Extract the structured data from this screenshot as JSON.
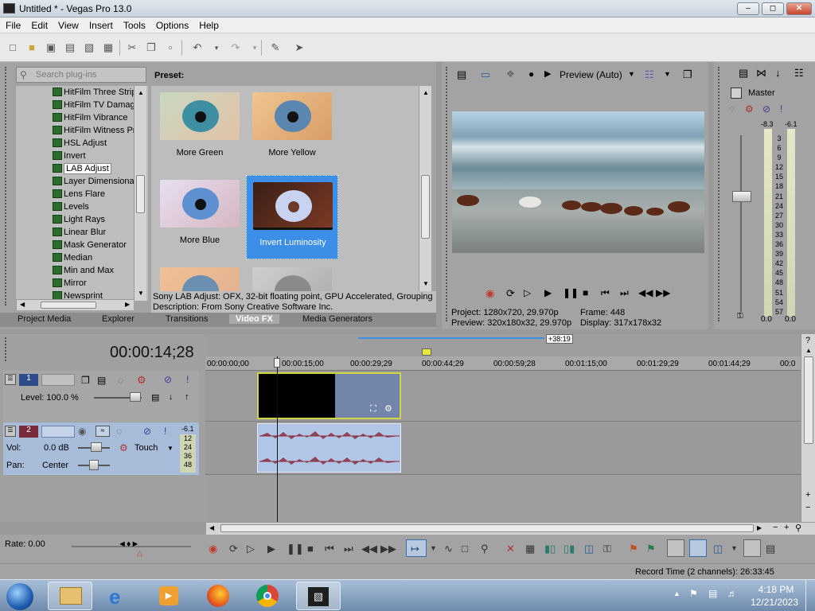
{
  "window": {
    "title": "Untitled * - Vegas Pro 13.0"
  },
  "menu": [
    "File",
    "Edit",
    "View",
    "Insert",
    "Tools",
    "Options",
    "Help"
  ],
  "plugins": {
    "search_placeholder": "Search plug-ins",
    "items": [
      "HitFilm Three Strip",
      "HitFilm TV Damage",
      "HitFilm Vibrance",
      "HitFilm Witness Pr",
      "HSL Adjust",
      "Invert",
      "LAB Adjust",
      "Layer Dimensional",
      "Lens Flare",
      "Levels",
      "Light Rays",
      "Linear Blur",
      "Mask Generator",
      "Median",
      "Min and Max",
      "Mirror",
      "Newsprint"
    ],
    "selected": "LAB Adjust"
  },
  "presets": {
    "label": "Preset:",
    "items": [
      {
        "name": "More Green",
        "iris": "#3f8fa3",
        "tint": "#cbe3d0"
      },
      {
        "name": "More Yellow",
        "iris": "#5a86b0",
        "tint": "#f0c58e"
      },
      {
        "name": "More Blue",
        "iris": "#5e8fd0",
        "tint": "#e7dff0"
      },
      {
        "name": "Invert Luminosity",
        "iris": "#c7d3f1",
        "tint": "#3a1e16"
      },
      {
        "name": "",
        "iris": "#6a8fb0",
        "tint": "#f0c096"
      },
      {
        "name": "",
        "iris": "#8a8a8a",
        "tint": "#cfcfcf"
      }
    ],
    "selected": "Invert Luminosity",
    "description_line1": "Sony LAB Adjust: OFX, 32-bit floating point, GPU Accelerated, Grouping",
    "description_line2": "Description: From Sony Creative Software Inc."
  },
  "tabs": [
    "Project Media",
    "Explorer",
    "Transitions",
    "Video FX",
    "Media Generators"
  ],
  "active_tab": "Video FX",
  "preview": {
    "mode": "Preview (Auto)",
    "project_label": "Project:",
    "project": "1280x720, 29.970p",
    "preview_label": "Preview:",
    "preview_res": "320x180x32, 29.970p",
    "frame_label": "Frame:",
    "frame": "448",
    "display_label": "Display:",
    "display": "317x178x32"
  },
  "master": {
    "label": "Master",
    "peak_left": "-8.3",
    "peak_right": "-6.1",
    "scale": [
      "3",
      "6",
      "9",
      "12",
      "15",
      "18",
      "21",
      "24",
      "27",
      "30",
      "33",
      "36",
      "39",
      "42",
      "45",
      "48",
      "51",
      "54",
      "57"
    ],
    "bottom_left": "0.0",
    "bottom_right": "0.0"
  },
  "timeline": {
    "timecode": "00:00:14;28",
    "ruler": [
      "00:00:00;00",
      "00:00:15;00",
      "00:00:29;29",
      "00:00:44;29",
      "00:00:59;28",
      "00:01:15;00",
      "00:01:29;29",
      "00:01:44;29",
      "00:0"
    ],
    "loop_label": "+38:19",
    "cursor_seconds": 14.93
  },
  "track1": {
    "number": "1",
    "level_label": "Level:",
    "level": "100.0 %"
  },
  "track2": {
    "number": "2",
    "peak": "-6.1",
    "vol_label": "Vol:",
    "vol": "0.0 dB",
    "pan_label": "Pan:",
    "pan": "Center",
    "touch": "Touch",
    "scale": [
      "12",
      "24",
      "36",
      "48"
    ]
  },
  "transport": {
    "rate_label": "Rate:",
    "rate": "0.00"
  },
  "status": {
    "record_time": "Record Time (2 channels): 26:33:45"
  },
  "clock": {
    "time": "4:18 PM",
    "date": "12/21/2023"
  },
  "colors": {
    "selection": "#3c8ee6",
    "video_event_border": "#cfd641",
    "audio_wave": "#8a2b3a"
  }
}
